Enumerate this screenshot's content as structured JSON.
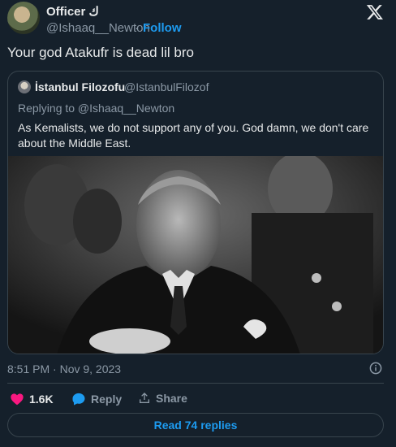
{
  "author": {
    "name": "Officer ك",
    "handle": "@Ishaaq__Newton",
    "separator": "·",
    "follow_label": "Follow"
  },
  "tweet": {
    "text": "Your god Atakufr is dead lil bro"
  },
  "quote": {
    "name": "İstanbul Filozofu",
    "handle": "@IstanbulFilozof",
    "replying_to": "Replying to @Ishaaq__Newton",
    "text": "As Kemalists, we do not support any of you. God damn, we don't care about the Middle East."
  },
  "meta": {
    "timestamp": "8:51 PM · Nov 9, 2023"
  },
  "actions": {
    "likes": "1.6K",
    "reply_label": "Reply",
    "share_label": "Share"
  },
  "read_replies_label": "Read 74 replies",
  "icons": [
    "x-logo-icon",
    "heart-icon",
    "reply-bubble-icon",
    "share-icon",
    "info-icon"
  ],
  "colors": {
    "background": "#15202b",
    "accent": "#1d9bf0",
    "like": "#f91880",
    "muted": "#8b98a5"
  }
}
